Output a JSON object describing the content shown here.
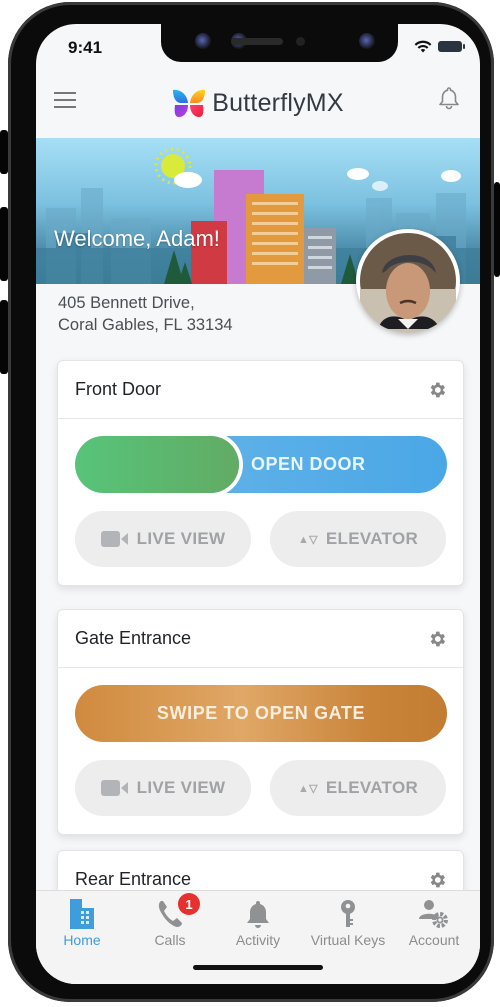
{
  "status_bar": {
    "time": "9:41"
  },
  "app_bar": {
    "brand": "ButterflyMX"
  },
  "banner": {
    "welcome": "Welcome, Adam!"
  },
  "address": {
    "line1": "405 Bennett Drive,",
    "line2": "Coral Gables, FL 33134"
  },
  "doors": [
    {
      "title": "Front Door",
      "slider_label": "OPEN DOOR",
      "slider_color": "#4aa7e6",
      "handle_color": "#5dbf75",
      "live_view": "LIVE VIEW",
      "elevator": "ELEVATOR"
    },
    {
      "title": "Gate Entrance",
      "slider_label": "SWIPE TO OPEN GATE",
      "slider_color": "#d08a3e",
      "live_view": "LIVE VIEW",
      "elevator": "ELEVATOR"
    },
    {
      "title": "Rear Entrance"
    }
  ],
  "tabs": [
    {
      "label": "Home",
      "icon": "building-icon",
      "active": true
    },
    {
      "label": "Calls",
      "icon": "phone-icon",
      "badge": "1"
    },
    {
      "label": "Activity",
      "icon": "bell-icon"
    },
    {
      "label": "Virtual Keys",
      "icon": "key-icon"
    },
    {
      "label": "Account",
      "icon": "account-gear-icon"
    }
  ],
  "colors": {
    "accent": "#3f9ddb",
    "badge": "#e7312f",
    "open_door": "#4aa7e6",
    "gate": "#d08a3e",
    "handle": "#5dbf75"
  }
}
